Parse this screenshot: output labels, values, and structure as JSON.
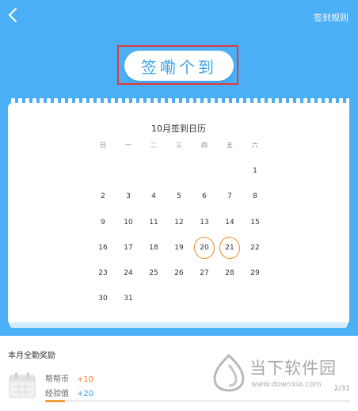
{
  "header": {
    "rules_label": "签到规则",
    "back_icon": "chevron-left-icon"
  },
  "checkin": {
    "button_label": "签嘞个到"
  },
  "calendar": {
    "title": "10月签到日历",
    "weekdays": [
      "日",
      "一",
      "二",
      "三",
      "四",
      "五",
      "六"
    ],
    "first_weekday_index": 6,
    "days": [
      "1",
      "2",
      "3",
      "4",
      "5",
      "6",
      "7",
      "8",
      "9",
      "10",
      "11",
      "12",
      "13",
      "14",
      "15",
      "16",
      "17",
      "18",
      "19",
      "20",
      "21",
      "22",
      "23",
      "24",
      "25",
      "26",
      "27",
      "28",
      "29",
      "30",
      "31"
    ],
    "circled_days": [
      "20",
      "21"
    ]
  },
  "monthly_award": {
    "title": "本月全勤奖励",
    "rewards": [
      {
        "label": "帮帮币",
        "value": "+10",
        "color": "#f07a2a"
      },
      {
        "label": "经验值",
        "value": "+20",
        "color": "#3d9ee6"
      }
    ],
    "progress_text": "2/31",
    "progress_fraction": 0.0645
  },
  "colors": {
    "background": "#4aaff5",
    "accent": "#42a5e8",
    "highlight": "#e23b3b",
    "circle": "#f08a2c"
  },
  "watermark": {
    "text": "当下软件园",
    "url": "www.downxia.com"
  }
}
